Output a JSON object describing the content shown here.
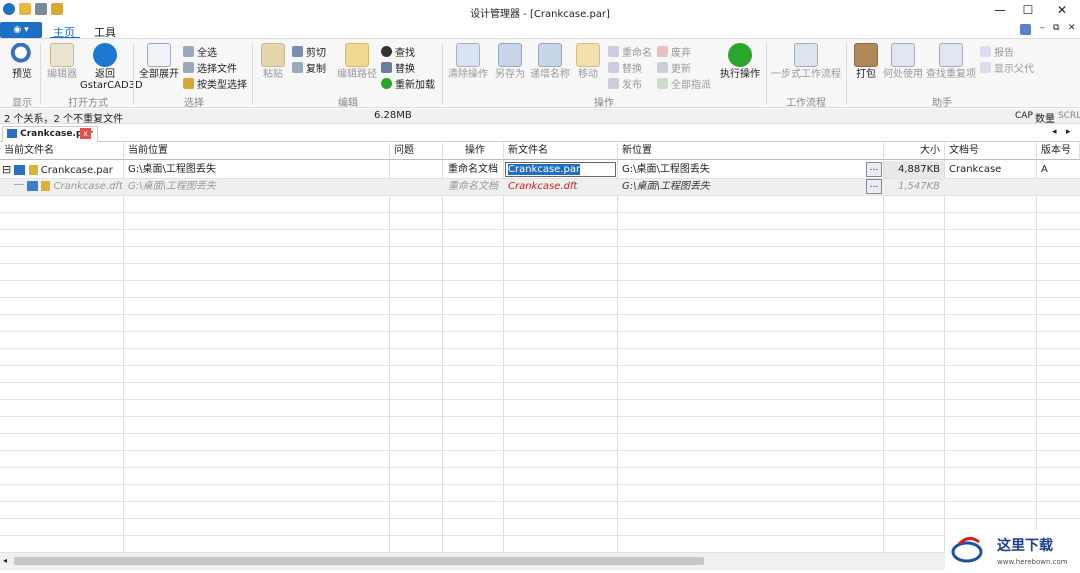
{
  "window": {
    "title": "设计管理器 - [Crankcase.par]",
    "minimize": "—",
    "maximize": "☐",
    "close": "✕",
    "ribbon_min": "–",
    "ribbon_restore": "⧉",
    "ribbon_close": "✕"
  },
  "tabs": {
    "home": "主页",
    "tools": "工具"
  },
  "ribbon": {
    "preview": "预览",
    "editor": "编辑器",
    "back_line1": "返回",
    "back_line2": "GstarCAD3D",
    "group_show": "显示",
    "group_open": "打开方式",
    "expand_all": "全部展开",
    "select_all": "全选",
    "select_file": "选择文件",
    "select_by_type": "按类型选择",
    "group_select": "选择",
    "paste": "粘贴",
    "cut": "剪切",
    "copy": "复制",
    "edit_path": "编辑路径",
    "find": "查找",
    "replace": "替换",
    "reload": "重新加载",
    "group_edit": "编辑",
    "clear_ops": "清除操作",
    "save_as": "另存为",
    "inc_name": "递增名称",
    "move": "移动",
    "rename": "重命名",
    "substitute": "替换",
    "publish": "发布",
    "obsolete": "废弃",
    "update": "更新",
    "assign_all": "全部指派",
    "execute": "执行操作",
    "group_ops": "操作",
    "one_step": "一步式工作流程",
    "group_workflow": "工作流程",
    "pack": "打包",
    "where_used": "何处使用",
    "find_dup": "查找重复项",
    "report": "报告",
    "show_parent": "显示父代",
    "group_helper": "助手"
  },
  "status": {
    "left": "2 个关系，2 个不重复文件",
    "size": "6.28MB",
    "cap": "CAP",
    "num": "数量",
    "scrl": "SCRL"
  },
  "doc_tab": {
    "label": "Crankcase.par",
    "close": "x"
  },
  "columns": [
    "当前文件名",
    "当前位置",
    "问题",
    "操作",
    "新文件名",
    "新位置",
    "大小",
    "文档号",
    "版本号"
  ],
  "rows": [
    {
      "name": "Crankcase.par",
      "location": "G:\\桌面\\工程图丢失",
      "problem": "",
      "op": "重命名文档",
      "new_name": "Crankcase.par",
      "new_loc": "G:\\桌面\\工程图丢失",
      "browse": "...",
      "size": "4,887KB",
      "docno": "Crankcase",
      "rev": "A"
    },
    {
      "name": "Crankcase.dft",
      "location": "G:\\桌面\\工程图丢失",
      "problem": "",
      "op": "重命名文档",
      "new_name": "Crankcase.dft",
      "new_loc": "G:\\桌面\\工程图丢失",
      "browse": "...",
      "size": "1,547KB",
      "docno": "",
      "rev": ""
    }
  ],
  "tree_toggle": "⊟",
  "colors": {
    "accent": "#1e6fc4",
    "selection": "#1e6fc4",
    "red_text": "#d42020",
    "execute_green": "#2aa62a"
  }
}
